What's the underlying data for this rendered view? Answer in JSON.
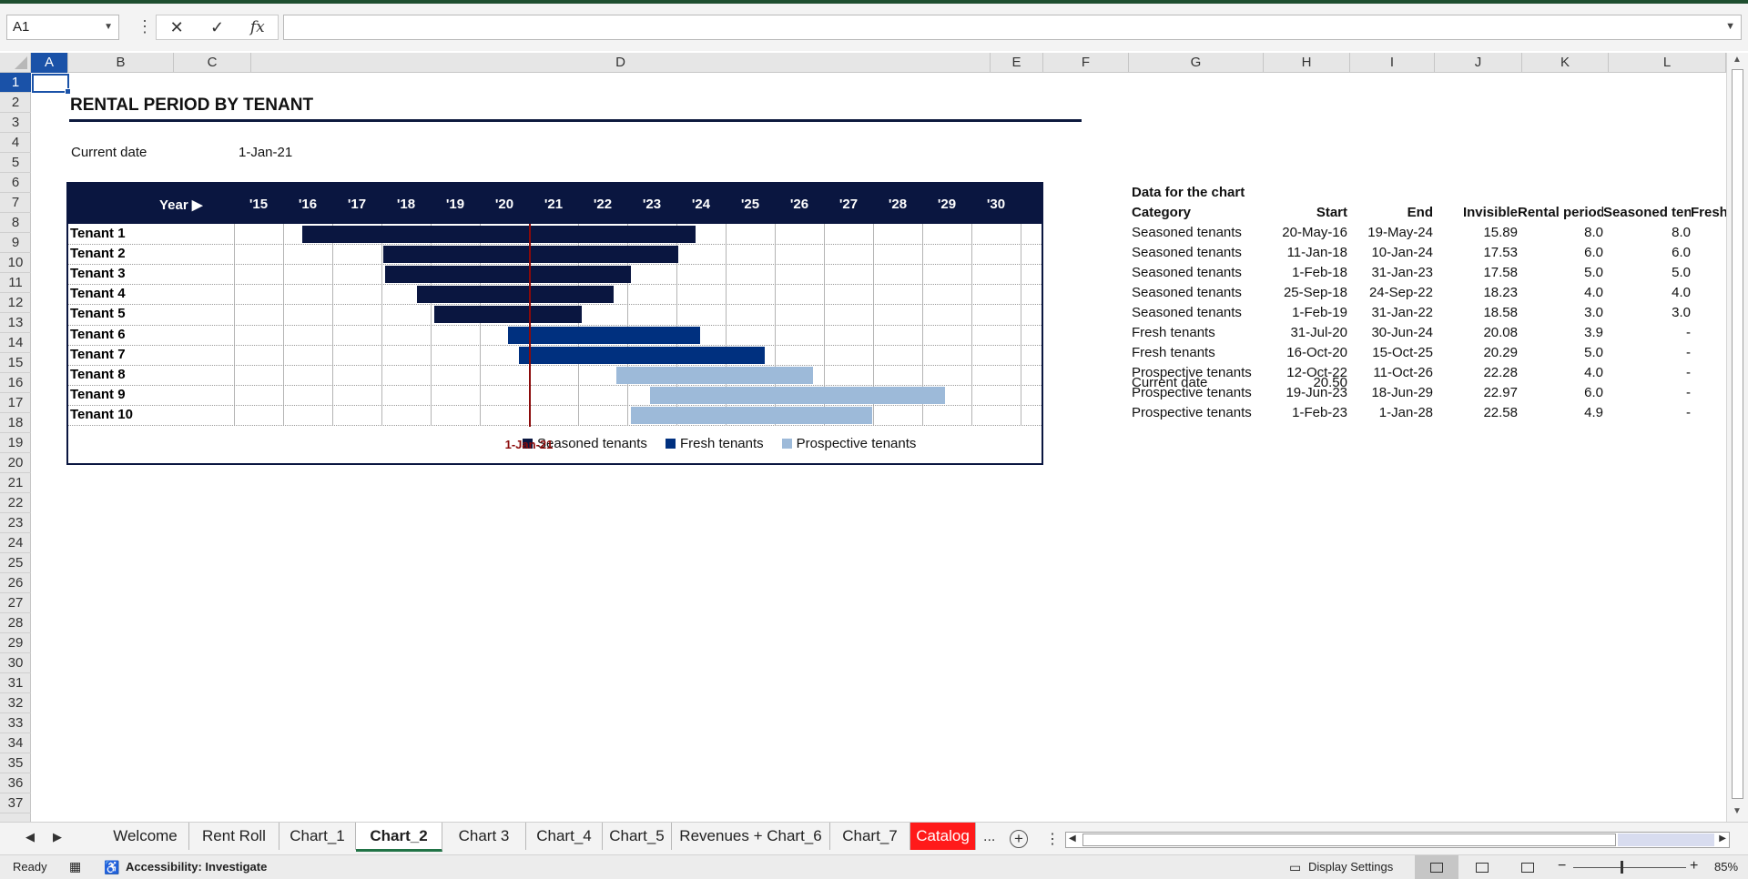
{
  "formula_bar": {
    "name_box": "A1",
    "formula_value": ""
  },
  "columns": [
    "A",
    "B",
    "C",
    "D",
    "E",
    "F",
    "G",
    "H",
    "I",
    "J",
    "K",
    "L"
  ],
  "rows": [
    "1",
    "2",
    "3",
    "4",
    "5",
    "6",
    "7",
    "8",
    "9",
    "10",
    "11",
    "12",
    "13",
    "14",
    "15",
    "16",
    "17",
    "18",
    "19",
    "20",
    "21",
    "22",
    "23",
    "24",
    "25",
    "26",
    "27",
    "28",
    "29",
    "30",
    "31",
    "32",
    "33",
    "34",
    "35",
    "36",
    "37"
  ],
  "sheet": {
    "title": "RENTAL PERIOD BY TENANT",
    "current_date_label": "Current date",
    "current_date_value": "1-Jan-21"
  },
  "chart_data": {
    "type": "bar",
    "subtype": "gantt",
    "title": "",
    "axis_label": "Year ▶",
    "tick_labels": [
      "'15",
      "'16",
      "'17",
      "'18",
      "'19",
      "'20",
      "'21",
      "'22",
      "'23",
      "'24",
      "'25",
      "'26",
      "'27",
      "'28",
      "'29",
      "'30"
    ],
    "xlim": [
      14.5,
      30.5
    ],
    "categories": [
      "Tenant 1",
      "Tenant 2",
      "Tenant 3",
      "Tenant 4",
      "Tenant 5",
      "Tenant 6",
      "Tenant 7",
      "Tenant 8",
      "Tenant 9",
      "Tenant 10"
    ],
    "start": [
      15.89,
      17.53,
      17.58,
      18.23,
      18.58,
      20.08,
      20.29,
      22.28,
      22.97,
      22.58
    ],
    "duration": [
      8.0,
      6.0,
      5.0,
      4.0,
      3.0,
      3.9,
      5.0,
      4.0,
      6.0,
      4.9
    ],
    "group": [
      "Seasoned tenants",
      "Seasoned tenants",
      "Seasoned tenants",
      "Seasoned tenants",
      "Seasoned tenants",
      "Fresh tenants",
      "Fresh tenants",
      "Prospective tenants",
      "Prospective tenants",
      "Prospective tenants"
    ],
    "series": [
      {
        "name": "Seasoned tenants",
        "color": "#0a1640"
      },
      {
        "name": "Fresh tenants",
        "color": "#00307f"
      },
      {
        "name": "Prospective tenants",
        "color": "#9dbad9"
      }
    ],
    "current_date": 20.5,
    "current_date_label": "1-Jan-21",
    "current_line_color": "#8b0a0a",
    "grid": true,
    "legend": "bottom-right"
  },
  "data_table": {
    "title": "Data for the chart",
    "headers": [
      "Category",
      "Start",
      "End",
      "Invisible",
      "Rental period",
      "Seasoned tenants",
      "Fresh"
    ],
    "rows": [
      [
        "Seasoned tenants",
        "20-May-16",
        "19-May-24",
        "15.89",
        "8.0",
        "8.0",
        ""
      ],
      [
        "Seasoned tenants",
        "11-Jan-18",
        "10-Jan-24",
        "17.53",
        "6.0",
        "6.0",
        ""
      ],
      [
        "Seasoned tenants",
        "1-Feb-18",
        "31-Jan-23",
        "17.58",
        "5.0",
        "5.0",
        ""
      ],
      [
        "Seasoned tenants",
        "25-Sep-18",
        "24-Sep-22",
        "18.23",
        "4.0",
        "4.0",
        ""
      ],
      [
        "Seasoned tenants",
        "1-Feb-19",
        "31-Jan-22",
        "18.58",
        "3.0",
        "3.0",
        ""
      ],
      [
        "Fresh tenants",
        "31-Jul-20",
        "30-Jun-24",
        "20.08",
        "3.9",
        "-",
        ""
      ],
      [
        "Fresh tenants",
        "16-Oct-20",
        "15-Oct-25",
        "20.29",
        "5.0",
        "-",
        ""
      ],
      [
        "Prospective tenants",
        "12-Oct-22",
        "11-Oct-26",
        "22.28",
        "4.0",
        "-",
        ""
      ],
      [
        "Prospective tenants",
        "19-Jun-23",
        "18-Jun-29",
        "22.97",
        "6.0",
        "-",
        ""
      ],
      [
        "Prospective tenants",
        "1-Feb-23",
        "1-Jan-28",
        "22.58",
        "4.9",
        "-",
        ""
      ]
    ],
    "current_date_label": "Current date",
    "current_date_value": "20.50"
  },
  "tabs": [
    {
      "label": "Welcome"
    },
    {
      "label": "Rent Roll"
    },
    {
      "label": "Chart_1"
    },
    {
      "label": "Chart_2"
    },
    {
      "label": "Chart 3"
    },
    {
      "label": "Chart_4"
    },
    {
      "label": "Chart_5"
    },
    {
      "label": "Revenues + Chart_6"
    },
    {
      "label": "Chart_7"
    },
    {
      "label": "Catalog"
    }
  ],
  "active_tab": "Chart_2",
  "tabs_more": "...",
  "status": {
    "ready": "Ready",
    "accessibility": "Accessibility: Investigate",
    "display_settings": "Display Settings",
    "zoom": "85%"
  }
}
